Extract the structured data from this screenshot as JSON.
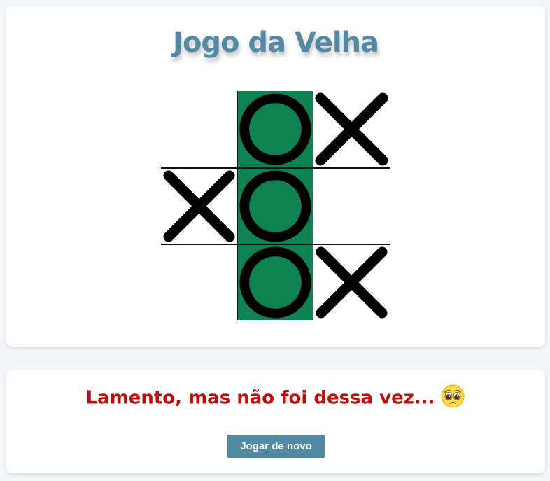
{
  "title": "Jogo da Velha",
  "board": {
    "cells": [
      "",
      "O",
      "X",
      "X",
      "O",
      "",
      "",
      "O",
      "X"
    ],
    "winning_cells": [
      1,
      4,
      7
    ],
    "win_color": "#0f8251",
    "mark_color": "#000000"
  },
  "result": {
    "message": "Lamento, mas não foi dessa vez...",
    "message_color": "#c20b0b",
    "emoji": "pleading-face-icon"
  },
  "replay_button": {
    "label": "Jogar de novo",
    "color": "#528aa3"
  },
  "accent_color": "#528aa3"
}
